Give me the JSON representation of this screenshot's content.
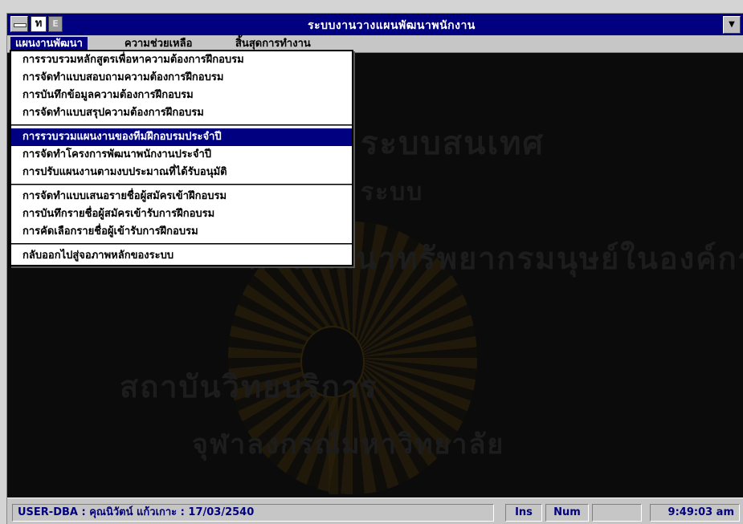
{
  "window": {
    "title": "ระบบงานวางแผนพัฒนาพนักงาน",
    "app_icon_glyph": "ท",
    "app_icon2_glyph": "E"
  },
  "menubar": {
    "items": [
      {
        "label": "แผนงานพัฒนา",
        "active": true
      },
      {
        "label": "ความช่วยเหลือ",
        "active": false
      },
      {
        "label": "สิ้นสุดการทำงาน",
        "active": false
      }
    ]
  },
  "dropdown": {
    "groups": [
      [
        "การรวบรวมหลักสูตรเพื่อหาความต้องการฝึกอบรม",
        "การจัดทำแบบสอบถามความต้องการฝึกอบรม",
        "การบันทึกข้อมูลความต้องการฝึกอบรม",
        "การจัดทำแบบสรุปความต้องการฝึกอบรม"
      ],
      [
        "การรวบรวมแผนงานของทีมฝึกอบรมประจำปี",
        "การจัดทำโครงการพัฒนาพนักงานประจำปี",
        "การปรับแผนงานตามงบประมาณที่ได้รับอนุมัติ"
      ],
      [
        "การจัดทำแบบเสนอรายชื่อผู้สมัครเข้าฝึกอบรม",
        "การบันทึกรายชื่อผู้สมัครเข้ารับการฝึกอบรม",
        "การคัดเลือกรายชื่อผู้เข้ารับการฝึกอบรม"
      ],
      [
        "กลับออกไปสู่จอภาพหลักของระบบ"
      ]
    ],
    "selected": "การรวบรวมแผนงานของทีมฝึกอบรมประจำปี"
  },
  "background_watermark": [
    "ระบบสนเทศ",
    "ระบบ",
    "การพัฒนาทรัพยากรมนุษย์ในองค์กร",
    "สถาบันวิทยบริการ",
    "จุฬาลงกรณ์มหาวิทยาลัย"
  ],
  "statusbar": {
    "user": "USER-DBA : คุณนิวัตน์ แก้วเกาะ : 17/03/2540",
    "ins": "Ins",
    "num": "Num",
    "empty": "",
    "time": "9:49:03 am"
  },
  "colors": {
    "titlebar": "#000080",
    "selection": "#000080",
    "desktop": "#0b0b0b",
    "status_text": "#000080"
  }
}
